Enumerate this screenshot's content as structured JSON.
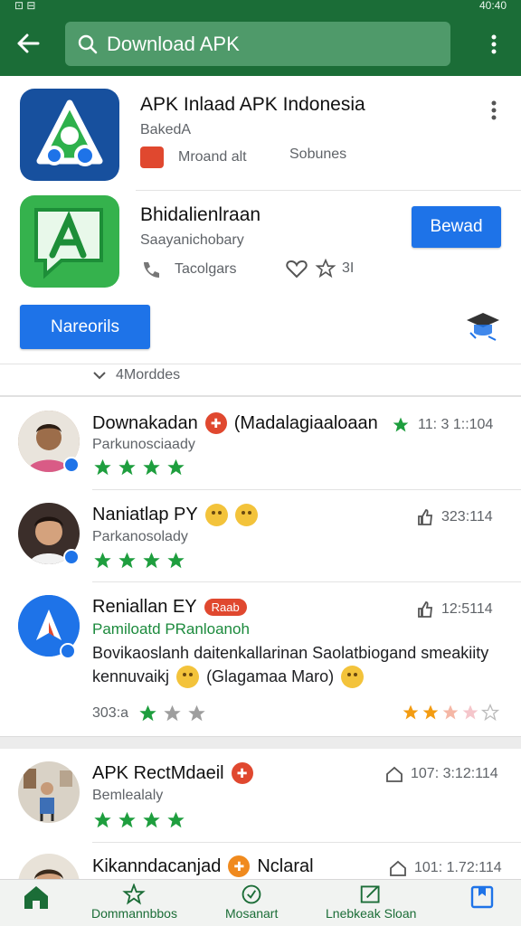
{
  "status_bar": {
    "left": "⊡ ⊟",
    "right": "40:40"
  },
  "header": {
    "search_text": "Download APK"
  },
  "apps": [
    {
      "title": "APK Inlaad APK Indonesia",
      "subtitle": "BakedA",
      "meta_left": "Mroand alt",
      "meta_right": "Sobunes"
    },
    {
      "title": "Bhidalienlraan",
      "subtitle": "Saayanichobary",
      "meta_left": "Tacolgars",
      "rating": "3I",
      "action": "Bewad"
    }
  ],
  "primary_button": "Nareorils",
  "more_label": "4Morddes",
  "reviews": [
    {
      "name": "Downakadan",
      "extra": "(Madalagiaaloaan",
      "sub": "Parkunosciaady",
      "stars": 4,
      "time": "11: 3 1::104"
    },
    {
      "name": "Naniatlap PY",
      "sub": "Parkanosolady",
      "stars": 4,
      "time": "323:114"
    },
    {
      "name": "Reniallan EY",
      "pill": "Raab",
      "headline": "Pamiloatd PRanloanoh",
      "body": "Bovikaoslanh daitenkallarinan Saolatbiogand smeakiity",
      "body2_pre": "kennuvaikj",
      "body2_mid": "(Glagamaa Maro)",
      "count": "303:a",
      "stars": 1,
      "time": "12:5114"
    },
    {
      "name": "APK RectMdaeil",
      "sub": "Bemlealaly",
      "stars": 4,
      "time": "107: 3:12:114"
    },
    {
      "name": "Kikanndacanjad",
      "extra": "Nclaral",
      "time": "101: 1.72:114"
    }
  ],
  "bottom_nav": [
    {
      "label": ""
    },
    {
      "label": "Dommannbbos"
    },
    {
      "label": "Mosanart"
    },
    {
      "label": "Lnebkeak Sloan"
    },
    {
      "label": ""
    }
  ],
  "colors": {
    "brand_green": "#1b6d37",
    "accent_blue": "#1e73e8",
    "star_green": "#1e9e3e",
    "star_orange": "#f39c12"
  }
}
